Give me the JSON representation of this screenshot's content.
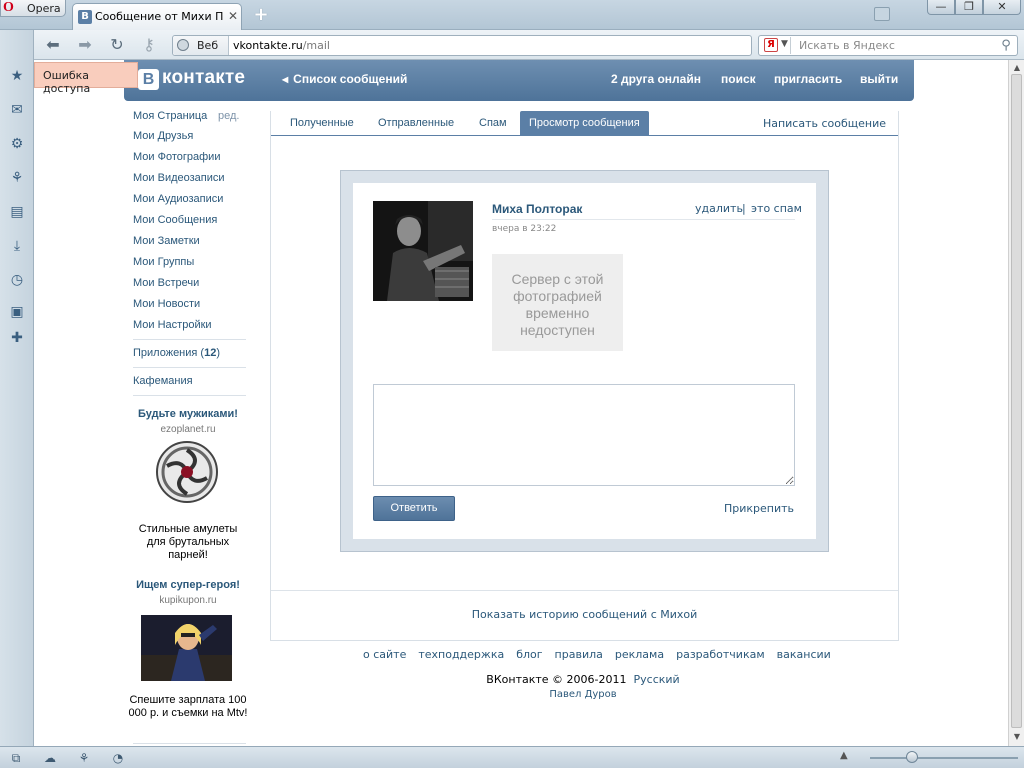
{
  "browser": {
    "menu_label": "Opera",
    "tab_title": "Сообщение от Михи Пол...",
    "address": {
      "prefix": "Веб",
      "host": "vkontakte.ru",
      "path": "/mail"
    },
    "search_placeholder": "Искать в Яндекс"
  },
  "error_tip": "Ошибка доступа",
  "header": {
    "logo_letter": "В",
    "logo_text": "контакте",
    "back_link": "Список сообщений",
    "friends_online": "2 друга онлайн",
    "search": "поиск",
    "invite": "пригласить",
    "logout": "выйти"
  },
  "sidebar": {
    "edit": "ред.",
    "items": [
      "Моя Страница",
      "Мои Друзья",
      "Мои Фотографии",
      "Мои Видеозаписи",
      "Мои Аудиозаписи",
      "Мои Сообщения",
      "Мои Заметки",
      "Мои Группы",
      "Мои Встречи",
      "Мои Новости",
      "Мои Настройки"
    ],
    "apps_label": "Приложения",
    "apps_count": "12",
    "cafe": "Кафемания",
    "ads": [
      {
        "title": "Будьте мужиками!",
        "domain": "ezoplanet.ru",
        "text": "Стильные амулеты для брутальных парней!"
      },
      {
        "title": "Ищем супер-героя!",
        "domain": "kupikupon.ru",
        "text": "Спешите зарплата 100 000 р. и съемки на Mtv!"
      }
    ]
  },
  "tabs": {
    "inbox": "Полученные",
    "sent": "Отправленные",
    "spam": "Спам",
    "view": "Просмотр сообщения",
    "write": "Написать сообщение"
  },
  "message": {
    "sender": "Миха Полторак",
    "delete": "удалить",
    "separator": "|",
    "spam": "это спам",
    "time": "вчера в 23:22",
    "photo_error": "Сервер с этой фотографией временно недоступен",
    "reply": "Ответить",
    "attach": "Прикрепить"
  },
  "history_link": "Показать историю сообщений с Михой",
  "footer": {
    "links": [
      "о сайте",
      "техподдержка",
      "блог",
      "правила",
      "реклама",
      "разработчикам",
      "вакансии"
    ],
    "copyright": "ВКонтакте © 2006-2011",
    "language": "Русский",
    "author": "Павел Дуров"
  },
  "colors": {
    "vk_blue": "#5b7fa6",
    "link": "#2b587a",
    "error_bg": "#f9cdbd"
  }
}
